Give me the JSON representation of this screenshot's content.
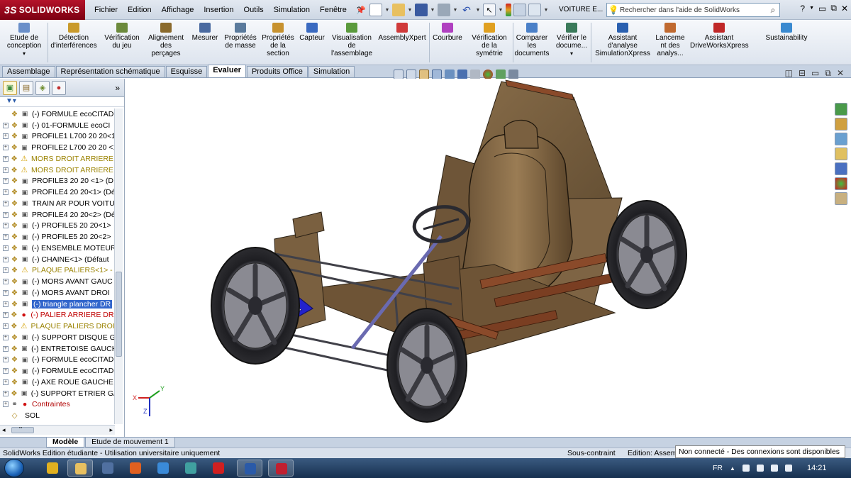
{
  "app": {
    "logo_prefix": "3S",
    "logo_text": "SOLIDWORKS",
    "document_title": "VOITURE E...",
    "menus": [
      "Fichier",
      "Edition",
      "Affichage",
      "Insertion",
      "Outils",
      "Simulation",
      "Fenêtre",
      "?"
    ],
    "help_search_placeholder": "Rechercher dans l'aide de SolidWorks"
  },
  "ribbon": {
    "buttons": [
      {
        "label": "Etude de\nconception",
        "icon": "design-study-icon",
        "color": "#6a8fc9"
      },
      {
        "label": "Détection\nd'interférences",
        "icon": "interference-icon",
        "color": "#c99a2c"
      },
      {
        "label": "Vérification\ndu jeu",
        "icon": "clearance-icon",
        "color": "#6c8a3c"
      },
      {
        "label": "Alignement\ndes\nperçages",
        "icon": "hole-align-icon",
        "color": "#8a6a2c"
      },
      {
        "label": "Mesurer",
        "icon": "measure-icon",
        "color": "#4a6aa0"
      },
      {
        "label": "Propriétés\nde masse",
        "icon": "mass-properties-icon",
        "color": "#5a7a9c"
      },
      {
        "label": "Propriétés\nde la\nsection",
        "icon": "section-properties-icon",
        "color": "#c7922f"
      },
      {
        "label": "Capteur",
        "icon": "sensor-icon",
        "color": "#3a6ac0"
      },
      {
        "label": "Visualisation\nde\nl'assemblage",
        "icon": "assembly-visualization-icon",
        "color": "#5a9a3c"
      },
      {
        "label": "AssemblyXpert",
        "icon": "assemblyxpert-icon",
        "color": "#d03a3a"
      },
      {
        "label": "Courbure",
        "icon": "curvature-icon",
        "color": "#b040c0"
      },
      {
        "label": "Vérification\nde la\nsymétrie",
        "icon": "symmetry-check-icon",
        "color": "#e0a020"
      },
      {
        "label": "Comparer\nles\ndocuments",
        "icon": "compare-documents-icon",
        "color": "#4a80c8"
      },
      {
        "label": "Vérifier le\ndocume...",
        "icon": "check-document-icon",
        "color": "#3a7a5a"
      },
      {
        "label": "Assistant\nd'analyse\nSimulationXpress",
        "icon": "simulationxpress-icon",
        "color": "#2a60b0"
      },
      {
        "label": "Lanceme\nnt des\nanalys...",
        "icon": "analysis-launch-icon",
        "color": "#c06a30"
      },
      {
        "label": "Assistant\nDriveWorksXpress",
        "icon": "driveworksxpress-icon",
        "color": "#c02828"
      },
      {
        "label": "Sustainability",
        "icon": "sustainability-icon",
        "color": "#3a8ad0"
      }
    ]
  },
  "tabs": [
    {
      "label": "Assemblage"
    },
    {
      "label": "Représentation schématique"
    },
    {
      "label": "Esquisse"
    },
    {
      "label": "Evaluer",
      "active": true
    },
    {
      "label": "Produits Office"
    },
    {
      "label": "Simulation"
    }
  ],
  "tree": {
    "expand_label": "»",
    "items": [
      {
        "label": "(-) FORMULE ecoCITAD",
        "state": "normal",
        "has_exp": false
      },
      {
        "label": "(-) 01-FORMULE ecoCI",
        "state": "normal"
      },
      {
        "label": "PROFILE1 L700 20 20<1",
        "state": "normal"
      },
      {
        "label": "PROFILE2 L700 20 20 <1",
        "state": "normal"
      },
      {
        "label": "MORS DROIT ARRIERE I",
        "state": "warn"
      },
      {
        "label": "MORS DROIT ARRIERE I",
        "state": "warn"
      },
      {
        "label": "PROFILE3 20 20 <1> (D",
        "state": "normal"
      },
      {
        "label": "PROFILE4 20 20<1> (Dé",
        "state": "normal"
      },
      {
        "label": "TRAIN AR POUR VOITU",
        "state": "normal"
      },
      {
        "label": "PROFILE4 20 20<2> (Dé",
        "state": "normal"
      },
      {
        "label": "(-) PROFILE5 20 20<1>",
        "state": "normal"
      },
      {
        "label": "(-) PROFILE5 20 20<2>",
        "state": "normal"
      },
      {
        "label": "(-) ENSEMBLE MOTEUR",
        "state": "normal"
      },
      {
        "label": "(-) CHAINE<1> (Défaut",
        "state": "normal"
      },
      {
        "label": "PLAQUE PALIERS<1> -",
        "state": "warn"
      },
      {
        "label": "(-) MORS AVANT GAUC",
        "state": "normal"
      },
      {
        "label": "(-) MORS AVANT DROI",
        "state": "normal"
      },
      {
        "label": "(-) triangle plancher DR",
        "state": "selected"
      },
      {
        "label": "(-) PALIER ARRIERE DRO",
        "state": "error"
      },
      {
        "label": "PLAQUE PALIERS DROIT",
        "state": "warn"
      },
      {
        "label": "(-) SUPPORT DISQUE G",
        "state": "normal"
      },
      {
        "label": "(-) ENTRETOISE GAUCH",
        "state": "normal"
      },
      {
        "label": "(-) FORMULE ecoCITAD",
        "state": "normal"
      },
      {
        "label": "(-) FORMULE ecoCITAD",
        "state": "normal"
      },
      {
        "label": "(-) AXE ROUE GAUCHE",
        "state": "normal"
      },
      {
        "label": "(-) SUPPORT ETRIER GA",
        "state": "normal"
      },
      {
        "label": "Contraintes",
        "state": "constraint"
      },
      {
        "label": "SOL",
        "state": "normal",
        "has_exp": false
      }
    ],
    "hscroll_label": "'''"
  },
  "triad": {
    "x": "X",
    "y": "Y",
    "z": "Z"
  },
  "model_tabs": [
    {
      "label": "Modèle",
      "active": true
    },
    {
      "label": "Etude de mouvement 1"
    }
  ],
  "status": {
    "left": "SolidWorks Edition étudiante - Utilisation universitaire uniquement",
    "state": "Sous-contraint",
    "edition": "Edition: Assem",
    "notification": "Non connecté - Des connexions sont disponibles"
  },
  "taskbar": {
    "language": "FR",
    "clock": "14:21",
    "apps": [
      {
        "name": "chrome-app-icon",
        "color": "#e0b020",
        "open": false
      },
      {
        "name": "explorer-app-icon",
        "color": "#e8c060",
        "open": true
      },
      {
        "name": "calculator-app-icon",
        "color": "#5070a0",
        "open": false
      },
      {
        "name": "firefox-app-icon",
        "color": "#e06020",
        "open": false
      },
      {
        "name": "ie-app-icon",
        "color": "#3a8ad8",
        "open": false
      },
      {
        "name": "network-app-icon",
        "color": "#40a0a0",
        "open": false
      },
      {
        "name": "acrobat-app-icon",
        "color": "#d02020",
        "open": false
      },
      {
        "name": "word-app-icon",
        "color": "#2a5aa8",
        "open": true
      },
      {
        "name": "solidworks-app-icon",
        "color": "#c02030",
        "open": true
      }
    ]
  },
  "colors": {
    "wood": "#7a6040",
    "wood_dark": "#4f3c26",
    "tire": "#2a2a2e",
    "rim": "#5a5a62",
    "frame": "#404048",
    "triangle": "#2222cc",
    "pipe": "#8a4a2a",
    "steering": "#6a6ab0"
  }
}
